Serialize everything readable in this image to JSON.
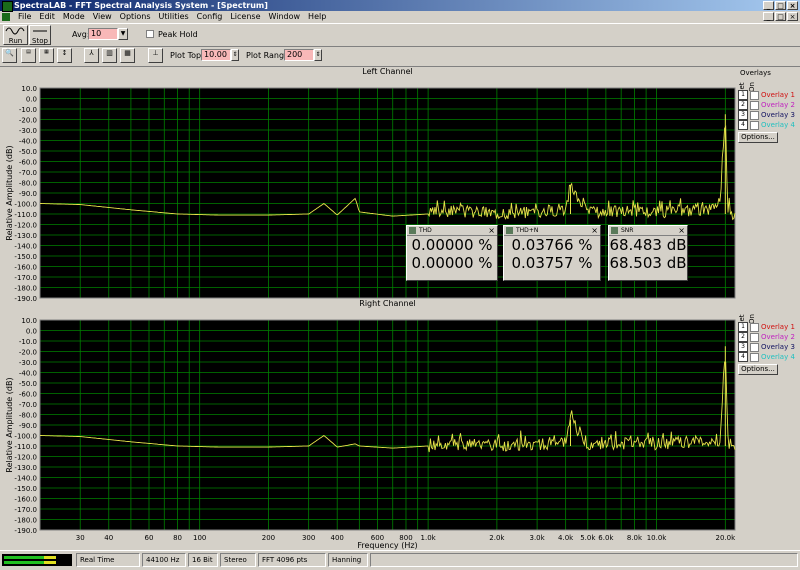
{
  "window": {
    "title": "SpectraLAB - FFT Spectral Analysis System - [Spectrum]"
  },
  "menu": [
    "File",
    "Edit",
    "Mode",
    "View",
    "Options",
    "Utilities",
    "Config",
    "License",
    "Window",
    "Help"
  ],
  "toolbar": {
    "run_label": "Run",
    "stop_label": "Stop",
    "avg_label": "Avg:",
    "avg_value": "10",
    "peak_hold_label": "Peak Hold",
    "plot_top_label": "Plot Top:",
    "plot_top_value": "10.00",
    "plot_range_label": "Plot Range:",
    "plot_range_value": "200"
  },
  "overlays": {
    "title": "Overlays",
    "set_label": "Set",
    "on_label": "On",
    "items": [
      {
        "num": "1",
        "label": "Overlay 1",
        "color": "#d01010"
      },
      {
        "num": "2",
        "label": "Overlay 2",
        "color": "#c020c0"
      },
      {
        "num": "3",
        "label": "Overlay 3",
        "color": "#101060"
      },
      {
        "num": "4",
        "label": "Overlay 4",
        "color": "#20c0c0"
      }
    ],
    "options_label": "Options..."
  },
  "meters": [
    {
      "title": "THD",
      "v1": "0.00000 %",
      "v2": "0.00000 %"
    },
    {
      "title": "THD+N",
      "v1": "0.03766 %",
      "v2": "0.03757 %"
    },
    {
      "title": "SNR",
      "v1": "68.483 dB",
      "v2": "68.503 dB"
    }
  ],
  "status": {
    "mode": "Real Time",
    "rate": "44100 Hz",
    "bits": "16 Bit",
    "channels": "Stereo",
    "fft": "FFT 4096 pts",
    "window": "Hanning"
  },
  "colors": {
    "plot_bg": "#000000",
    "grid": "#008000",
    "trace": "#e6e24a",
    "axis_text": "#000000"
  },
  "chart_data": [
    {
      "type": "line",
      "title": "Left Channel",
      "xlabel": "Frequency (Hz)",
      "ylabel": "Relative Amplitude (dB)",
      "x_scale": "log",
      "xlim": [
        20,
        22050
      ],
      "ylim": [
        -190,
        10
      ],
      "y_ticks": [
        "10.0",
        "0.0",
        "-10.0",
        "-20.0",
        "-30.0",
        "-40.0",
        "-50.0",
        "-60.0",
        "-70.0",
        "-80.0",
        "-90.0",
        "-100.0",
        "-110.0",
        "-120.0",
        "-130.0",
        "-140.0",
        "-150.0",
        "-160.0",
        "-170.0",
        "-180.0",
        "-190.0"
      ],
      "x_ticks": [
        {
          "v": 30,
          "t": "30"
        },
        {
          "v": 40,
          "t": "40"
        },
        {
          "v": 60,
          "t": "60"
        },
        {
          "v": 80,
          "t": "80"
        },
        {
          "v": 100,
          "t": "100"
        },
        {
          "v": 200,
          "t": "200"
        },
        {
          "v": 300,
          "t": "300"
        },
        {
          "v": 400,
          "t": "400"
        },
        {
          "v": 600,
          "t": "600"
        },
        {
          "v": 800,
          "t": "800"
        },
        {
          "v": 1000,
          "t": "1.0k"
        },
        {
          "v": 2000,
          "t": "2.0k"
        },
        {
          "v": 3000,
          "t": "3.0k"
        },
        {
          "v": 4000,
          "t": "4.0k"
        },
        {
          "v": 5000,
          "t": "5.0k"
        },
        {
          "v": 6000,
          "t": "6.0k"
        },
        {
          "v": 8000,
          "t": "8.0k"
        },
        {
          "v": 10000,
          "t": "10.0k"
        },
        {
          "v": 20000,
          "t": "20.0k"
        }
      ],
      "series": [
        {
          "x": [
            20,
            30,
            50,
            80,
            120,
            200,
            300,
            350,
            400,
            480,
            500,
            700,
            1000,
            1200,
            2000,
            3000,
            4000,
            4200,
            5000,
            8000,
            10000,
            15000,
            19000,
            20000,
            20500,
            21000,
            22050
          ],
          "y": [
            -100,
            -101,
            -106,
            -110,
            -111,
            -111,
            -110,
            -100,
            -111,
            -95,
            -108,
            -112,
            -110,
            -107,
            -109,
            -108,
            -105,
            -83,
            -108,
            -107,
            -108,
            -106,
            -104,
            -15,
            -104,
            -110,
            -111
          ]
        }
      ]
    },
    {
      "type": "line",
      "title": "Right Channel",
      "xlabel": "Frequency (Hz)",
      "ylabel": "Relative Amplitude (dB)",
      "x_scale": "log",
      "xlim": [
        20,
        22050
      ],
      "ylim": [
        -190,
        10
      ],
      "series": [
        {
          "x": [
            20,
            30,
            50,
            80,
            120,
            200,
            300,
            350,
            400,
            480,
            500,
            700,
            1000,
            1200,
            2000,
            3000,
            4000,
            4200,
            5000,
            8000,
            10000,
            15000,
            19000,
            20000,
            20500,
            21000,
            22050
          ],
          "y": [
            -100,
            -101,
            -106,
            -110,
            -111,
            -111,
            -110,
            -100,
            -111,
            -108,
            -110,
            -112,
            -110,
            -108,
            -109,
            -108,
            -106,
            -85,
            -108,
            -107,
            -108,
            -106,
            -104,
            -15,
            -104,
            -110,
            -111
          ]
        }
      ]
    }
  ]
}
